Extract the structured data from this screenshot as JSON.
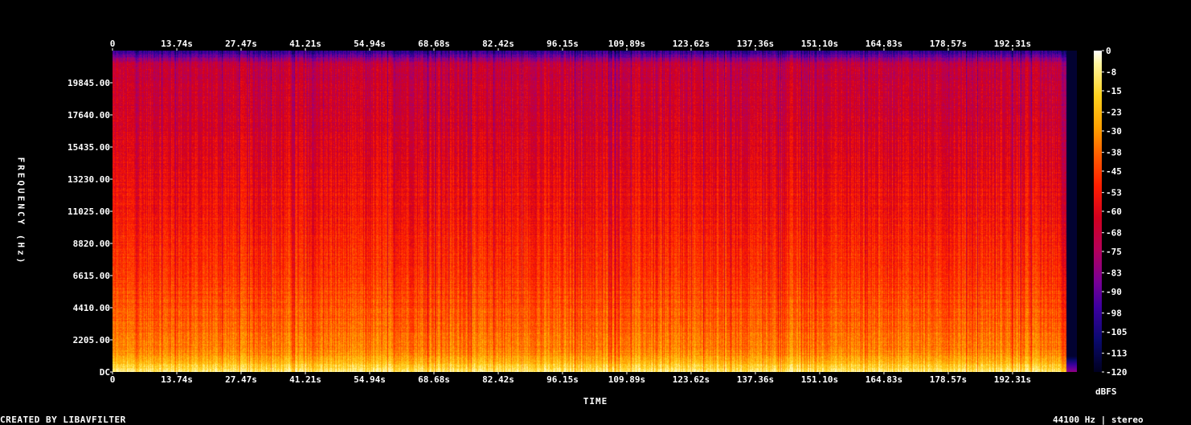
{
  "chart_data": {
    "type": "heatmap",
    "title": "",
    "xlabel": "TIME",
    "ylabel": "FREQUENCY (Hz)",
    "colorbar_label": "dBFS",
    "x_ticks": [
      "0",
      "13.74s",
      "27.47s",
      "41.21s",
      "54.94s",
      "68.68s",
      "82.42s",
      "96.15s",
      "109.89s",
      "123.62s",
      "137.36s",
      "151.10s",
      "164.83s",
      "178.57s",
      "192.31s"
    ],
    "x_tick_values": [
      0,
      13.74,
      27.47,
      41.21,
      54.94,
      68.68,
      82.42,
      96.15,
      109.89,
      123.62,
      137.36,
      151.1,
      164.83,
      178.57,
      192.31
    ],
    "xlim": [
      0,
      206.05
    ],
    "y_ticks": [
      "DC",
      "2205.00",
      "4410.00",
      "6615.00",
      "8820.00",
      "11025.00",
      "13230.00",
      "15435.00",
      "17640.00",
      "19845.00"
    ],
    "y_tick_values": [
      0,
      2205,
      4410,
      6615,
      8820,
      11025,
      13230,
      15435,
      17640,
      19845
    ],
    "ylim": [
      0,
      22050
    ],
    "colorbar_ticks": [
      "0",
      "-8",
      "-15",
      "-23",
      "-30",
      "-38",
      "-45",
      "-53",
      "-60",
      "-68",
      "-75",
      "-83",
      "-90",
      "-98",
      "-105",
      "-113",
      "-120"
    ],
    "colorbar_values": [
      0,
      -8,
      -15,
      -23,
      -30,
      -38,
      -45,
      -53,
      -60,
      -68,
      -75,
      -83,
      -90,
      -98,
      -105,
      -113,
      -120
    ],
    "clim": [
      -120,
      0
    ],
    "colormap": [
      "#000020",
      "#0a0a6e",
      "#3c00a0",
      "#780096",
      "#b4005a",
      "#d2001e",
      "#ff1e00",
      "#ff5a00",
      "#ffa000",
      "#ffd21e",
      "#fff6a0",
      "#ffffff"
    ],
    "audio_end_time": 201.6
  },
  "footer": {
    "left": "CREATED BY LIBAVFILTER",
    "right": "44100 Hz | stereo"
  }
}
